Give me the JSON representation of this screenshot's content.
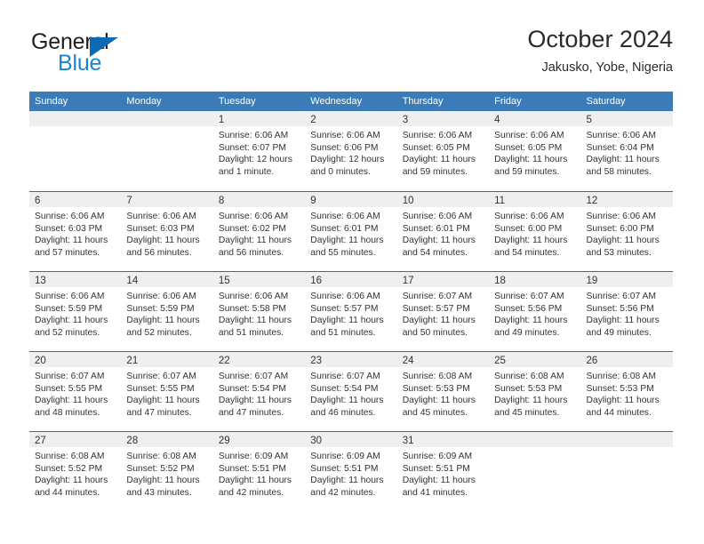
{
  "logo": {
    "word_one": "General",
    "word_two": "Blue",
    "triangle_color": "#0c6ab4",
    "blue_color": "#1b84cc",
    "dark_color": "#231f20"
  },
  "header": {
    "title": "October 2024",
    "location": "Jakusko, Yobe, Nigeria"
  },
  "theme": {
    "header_band": "#3b7cb8",
    "row_divider": "#2c6fb0",
    "day_band": "#efefef",
    "text": "#333333"
  },
  "weekdays": [
    "Sunday",
    "Monday",
    "Tuesday",
    "Wednesday",
    "Thursday",
    "Friday",
    "Saturday"
  ],
  "weeks": [
    [
      {
        "empty": true
      },
      {
        "empty": true
      },
      {
        "day": "1",
        "sunrise": "Sunrise: 6:06 AM",
        "sunset": "Sunset: 6:07 PM",
        "daylight_1": "Daylight: 12 hours",
        "daylight_2": "and 1 minute."
      },
      {
        "day": "2",
        "sunrise": "Sunrise: 6:06 AM",
        "sunset": "Sunset: 6:06 PM",
        "daylight_1": "Daylight: 12 hours",
        "daylight_2": "and 0 minutes."
      },
      {
        "day": "3",
        "sunrise": "Sunrise: 6:06 AM",
        "sunset": "Sunset: 6:05 PM",
        "daylight_1": "Daylight: 11 hours",
        "daylight_2": "and 59 minutes."
      },
      {
        "day": "4",
        "sunrise": "Sunrise: 6:06 AM",
        "sunset": "Sunset: 6:05 PM",
        "daylight_1": "Daylight: 11 hours",
        "daylight_2": "and 59 minutes."
      },
      {
        "day": "5",
        "sunrise": "Sunrise: 6:06 AM",
        "sunset": "Sunset: 6:04 PM",
        "daylight_1": "Daylight: 11 hours",
        "daylight_2": "and 58 minutes."
      }
    ],
    [
      {
        "day": "6",
        "sunrise": "Sunrise: 6:06 AM",
        "sunset": "Sunset: 6:03 PM",
        "daylight_1": "Daylight: 11 hours",
        "daylight_2": "and 57 minutes."
      },
      {
        "day": "7",
        "sunrise": "Sunrise: 6:06 AM",
        "sunset": "Sunset: 6:03 PM",
        "daylight_1": "Daylight: 11 hours",
        "daylight_2": "and 56 minutes."
      },
      {
        "day": "8",
        "sunrise": "Sunrise: 6:06 AM",
        "sunset": "Sunset: 6:02 PM",
        "daylight_1": "Daylight: 11 hours",
        "daylight_2": "and 56 minutes."
      },
      {
        "day": "9",
        "sunrise": "Sunrise: 6:06 AM",
        "sunset": "Sunset: 6:01 PM",
        "daylight_1": "Daylight: 11 hours",
        "daylight_2": "and 55 minutes."
      },
      {
        "day": "10",
        "sunrise": "Sunrise: 6:06 AM",
        "sunset": "Sunset: 6:01 PM",
        "daylight_1": "Daylight: 11 hours",
        "daylight_2": "and 54 minutes."
      },
      {
        "day": "11",
        "sunrise": "Sunrise: 6:06 AM",
        "sunset": "Sunset: 6:00 PM",
        "daylight_1": "Daylight: 11 hours",
        "daylight_2": "and 54 minutes."
      },
      {
        "day": "12",
        "sunrise": "Sunrise: 6:06 AM",
        "sunset": "Sunset: 6:00 PM",
        "daylight_1": "Daylight: 11 hours",
        "daylight_2": "and 53 minutes."
      }
    ],
    [
      {
        "day": "13",
        "sunrise": "Sunrise: 6:06 AM",
        "sunset": "Sunset: 5:59 PM",
        "daylight_1": "Daylight: 11 hours",
        "daylight_2": "and 52 minutes."
      },
      {
        "day": "14",
        "sunrise": "Sunrise: 6:06 AM",
        "sunset": "Sunset: 5:59 PM",
        "daylight_1": "Daylight: 11 hours",
        "daylight_2": "and 52 minutes."
      },
      {
        "day": "15",
        "sunrise": "Sunrise: 6:06 AM",
        "sunset": "Sunset: 5:58 PM",
        "daylight_1": "Daylight: 11 hours",
        "daylight_2": "and 51 minutes."
      },
      {
        "day": "16",
        "sunrise": "Sunrise: 6:06 AM",
        "sunset": "Sunset: 5:57 PM",
        "daylight_1": "Daylight: 11 hours",
        "daylight_2": "and 51 minutes."
      },
      {
        "day": "17",
        "sunrise": "Sunrise: 6:07 AM",
        "sunset": "Sunset: 5:57 PM",
        "daylight_1": "Daylight: 11 hours",
        "daylight_2": "and 50 minutes."
      },
      {
        "day": "18",
        "sunrise": "Sunrise: 6:07 AM",
        "sunset": "Sunset: 5:56 PM",
        "daylight_1": "Daylight: 11 hours",
        "daylight_2": "and 49 minutes."
      },
      {
        "day": "19",
        "sunrise": "Sunrise: 6:07 AM",
        "sunset": "Sunset: 5:56 PM",
        "daylight_1": "Daylight: 11 hours",
        "daylight_2": "and 49 minutes."
      }
    ],
    [
      {
        "day": "20",
        "sunrise": "Sunrise: 6:07 AM",
        "sunset": "Sunset: 5:55 PM",
        "daylight_1": "Daylight: 11 hours",
        "daylight_2": "and 48 minutes."
      },
      {
        "day": "21",
        "sunrise": "Sunrise: 6:07 AM",
        "sunset": "Sunset: 5:55 PM",
        "daylight_1": "Daylight: 11 hours",
        "daylight_2": "and 47 minutes."
      },
      {
        "day": "22",
        "sunrise": "Sunrise: 6:07 AM",
        "sunset": "Sunset: 5:54 PM",
        "daylight_1": "Daylight: 11 hours",
        "daylight_2": "and 47 minutes."
      },
      {
        "day": "23",
        "sunrise": "Sunrise: 6:07 AM",
        "sunset": "Sunset: 5:54 PM",
        "daylight_1": "Daylight: 11 hours",
        "daylight_2": "and 46 minutes."
      },
      {
        "day": "24",
        "sunrise": "Sunrise: 6:08 AM",
        "sunset": "Sunset: 5:53 PM",
        "daylight_1": "Daylight: 11 hours",
        "daylight_2": "and 45 minutes."
      },
      {
        "day": "25",
        "sunrise": "Sunrise: 6:08 AM",
        "sunset": "Sunset: 5:53 PM",
        "daylight_1": "Daylight: 11 hours",
        "daylight_2": "and 45 minutes."
      },
      {
        "day": "26",
        "sunrise": "Sunrise: 6:08 AM",
        "sunset": "Sunset: 5:53 PM",
        "daylight_1": "Daylight: 11 hours",
        "daylight_2": "and 44 minutes."
      }
    ],
    [
      {
        "day": "27",
        "sunrise": "Sunrise: 6:08 AM",
        "sunset": "Sunset: 5:52 PM",
        "daylight_1": "Daylight: 11 hours",
        "daylight_2": "and 44 minutes."
      },
      {
        "day": "28",
        "sunrise": "Sunrise: 6:08 AM",
        "sunset": "Sunset: 5:52 PM",
        "daylight_1": "Daylight: 11 hours",
        "daylight_2": "and 43 minutes."
      },
      {
        "day": "29",
        "sunrise": "Sunrise: 6:09 AM",
        "sunset": "Sunset: 5:51 PM",
        "daylight_1": "Daylight: 11 hours",
        "daylight_2": "and 42 minutes."
      },
      {
        "day": "30",
        "sunrise": "Sunrise: 6:09 AM",
        "sunset": "Sunset: 5:51 PM",
        "daylight_1": "Daylight: 11 hours",
        "daylight_2": "and 42 minutes."
      },
      {
        "day": "31",
        "sunrise": "Sunrise: 6:09 AM",
        "sunset": "Sunset: 5:51 PM",
        "daylight_1": "Daylight: 11 hours",
        "daylight_2": "and 41 minutes."
      },
      {
        "empty": true
      },
      {
        "empty": true
      }
    ]
  ]
}
